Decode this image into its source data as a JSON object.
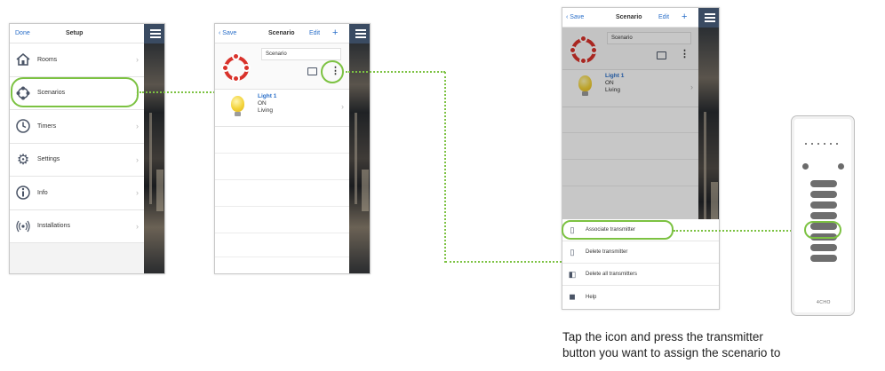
{
  "colors": {
    "accent_green": "#7cc242",
    "nav_blue": "#2a6fc9",
    "menu_bg": "#3a4b62",
    "scenario_red": "#d9322b"
  },
  "phone1": {
    "nav": {
      "left": "Done",
      "title": "Setup"
    },
    "items": [
      {
        "label": "Rooms",
        "icon": "house-icon"
      },
      {
        "label": "Scenarios",
        "icon": "scenario-icon"
      },
      {
        "label": "Timers",
        "icon": "clock-icon"
      },
      {
        "label": "Settings",
        "icon": "gear-icon"
      },
      {
        "label": "Info",
        "icon": "info-icon"
      },
      {
        "label": "Installations",
        "icon": "signal-icon"
      }
    ]
  },
  "phone2": {
    "nav": {
      "left": "Save",
      "title": "Scenario",
      "edit": "Edit",
      "add": "+"
    },
    "scenario_name": "Scenario",
    "light": {
      "name": "Light 1",
      "state": "ON",
      "room": "Living"
    }
  },
  "phone3": {
    "nav": {
      "left": "Save",
      "title": "Scenario",
      "edit": "Edit",
      "add": "+"
    },
    "scenario_name": "Scenario",
    "light": {
      "name": "Light 1",
      "state": "ON",
      "room": "Living"
    },
    "sheet": [
      {
        "label": "Associate transmitter",
        "icon": "transmitter-icon"
      },
      {
        "label": "Delete transmitter",
        "icon": "transmitter-delete-icon"
      },
      {
        "label": "Delete all transmitters",
        "icon": "copy-icon"
      },
      {
        "label": "Help",
        "icon": "help-icon"
      }
    ]
  },
  "remote": {
    "logo": "4CHO"
  },
  "caption": {
    "line1": "Tap the icon and press the transmitter",
    "line2": "button you want to assign the scenario to"
  }
}
